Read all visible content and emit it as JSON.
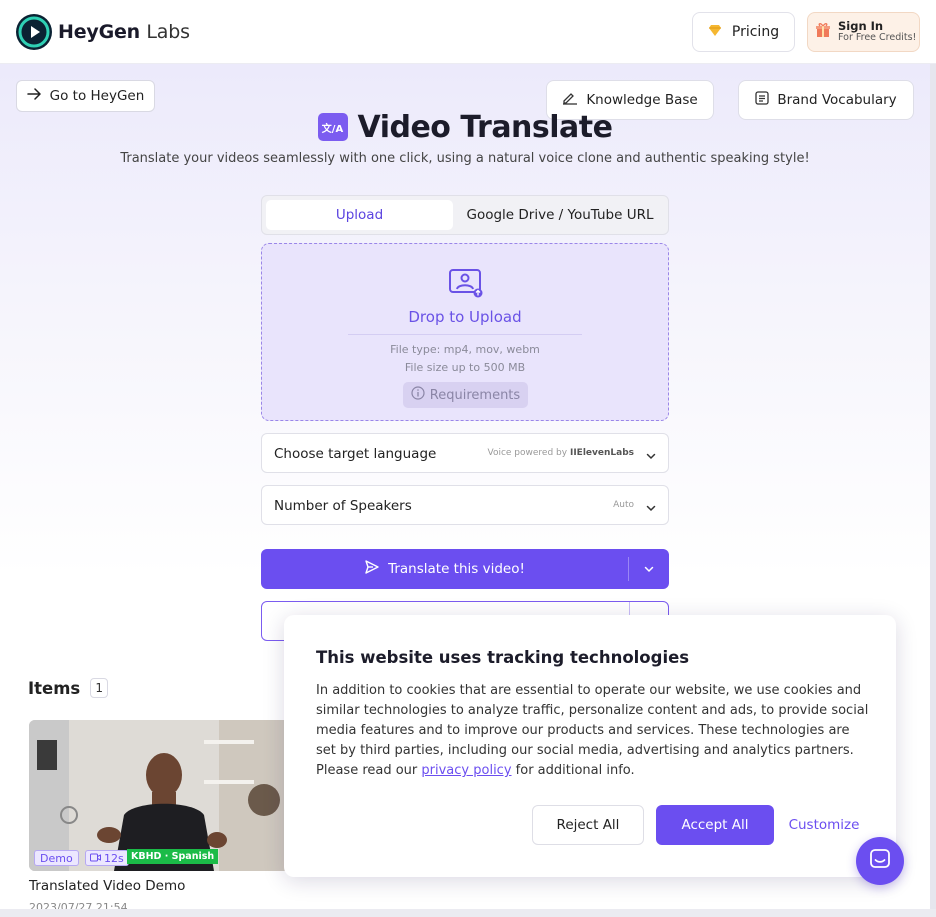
{
  "header": {
    "logo_main": "HeyGen",
    "logo_sub": "Labs",
    "pricing_label": "Pricing",
    "signin_title": "Sign In",
    "signin_sub": "For Free Credits!"
  },
  "nav": {
    "goto_label": "Go to HeyGen",
    "knowledge_base_label": "Knowledge Base",
    "brand_vocab_label": "Brand Vocabulary"
  },
  "hero": {
    "icon_text": "文/A",
    "title": "Video Translate",
    "subtitle": "Translate your videos seamlessly with one click, using a natural voice clone and authentic speaking style!"
  },
  "tabs": [
    {
      "label": "Upload",
      "active": true
    },
    {
      "label": "Google Drive / YouTube URL",
      "active": false
    }
  ],
  "dropzone": {
    "title": "Drop to Upload",
    "file_type": "File type: mp4, mov, webm",
    "file_size": "File size up to 500 MB",
    "requirements_label": "Requirements"
  },
  "selects": {
    "language_label": "Choose target language",
    "language_hint": "Voice powered by",
    "language_brand": "IIElevenLabs",
    "speakers_label": "Number of Speakers",
    "speakers_hint": "Auto"
  },
  "actions": {
    "translate_label": "Translate this video!"
  },
  "items": {
    "title": "Items",
    "count": "1",
    "list": [
      {
        "badge_demo": "Demo",
        "duration": "12s",
        "lang_badge": "KBHD · Spanish",
        "title": "Translated Video Demo",
        "date": "2023/07/27 21:54"
      }
    ]
  },
  "cookie": {
    "title": "This website uses tracking technologies",
    "body_before": "In addition to cookies that are essential to operate our website, we use cookies and similar technologies to analyze traffic, personalize content and ads, to provide social media features and to improve our products and services. These technologies are set by third parties, including our social media, advertising and analytics partners. Please read our ",
    "link_text": "privacy policy",
    "body_after": " for additional info.",
    "reject_label": "Reject All",
    "accept_label": "Accept All",
    "customize_label": "Customize"
  },
  "colors": {
    "accent": "#6b4ef0",
    "dropzone_bg": "#e9e4fc",
    "lang_badge": "#1bbb48",
    "signin_bg": "#fdf1e7"
  }
}
